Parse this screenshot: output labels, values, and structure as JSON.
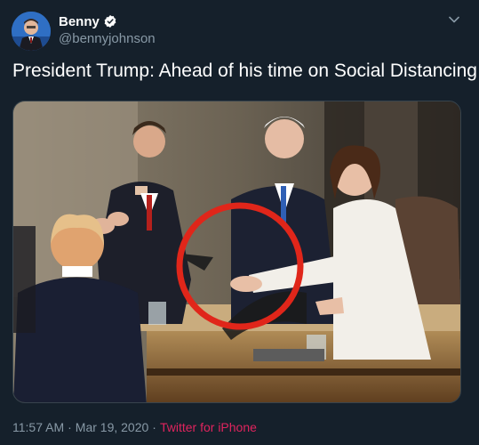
{
  "user": {
    "display_name": "Benny",
    "handle": "@bennyjohnson",
    "verified": true,
    "verified_icon": "verified-badge-icon"
  },
  "tweet": {
    "text": "President Trump: Ahead of his time on Social Distancing",
    "time": "11:57 AM",
    "separator": "·",
    "date": "Mar 19, 2020",
    "separator2": "·",
    "source": "Twitter for iPhone"
  },
  "media": {
    "description_icon": "photo"
  },
  "menu": {
    "icon": "chevron-down-icon"
  },
  "colors": {
    "background": "#15202b",
    "text_primary": "#ffffff",
    "text_secondary": "#8899a6",
    "source_link": "#e0245e",
    "highlight_circle": "#e0261a"
  }
}
